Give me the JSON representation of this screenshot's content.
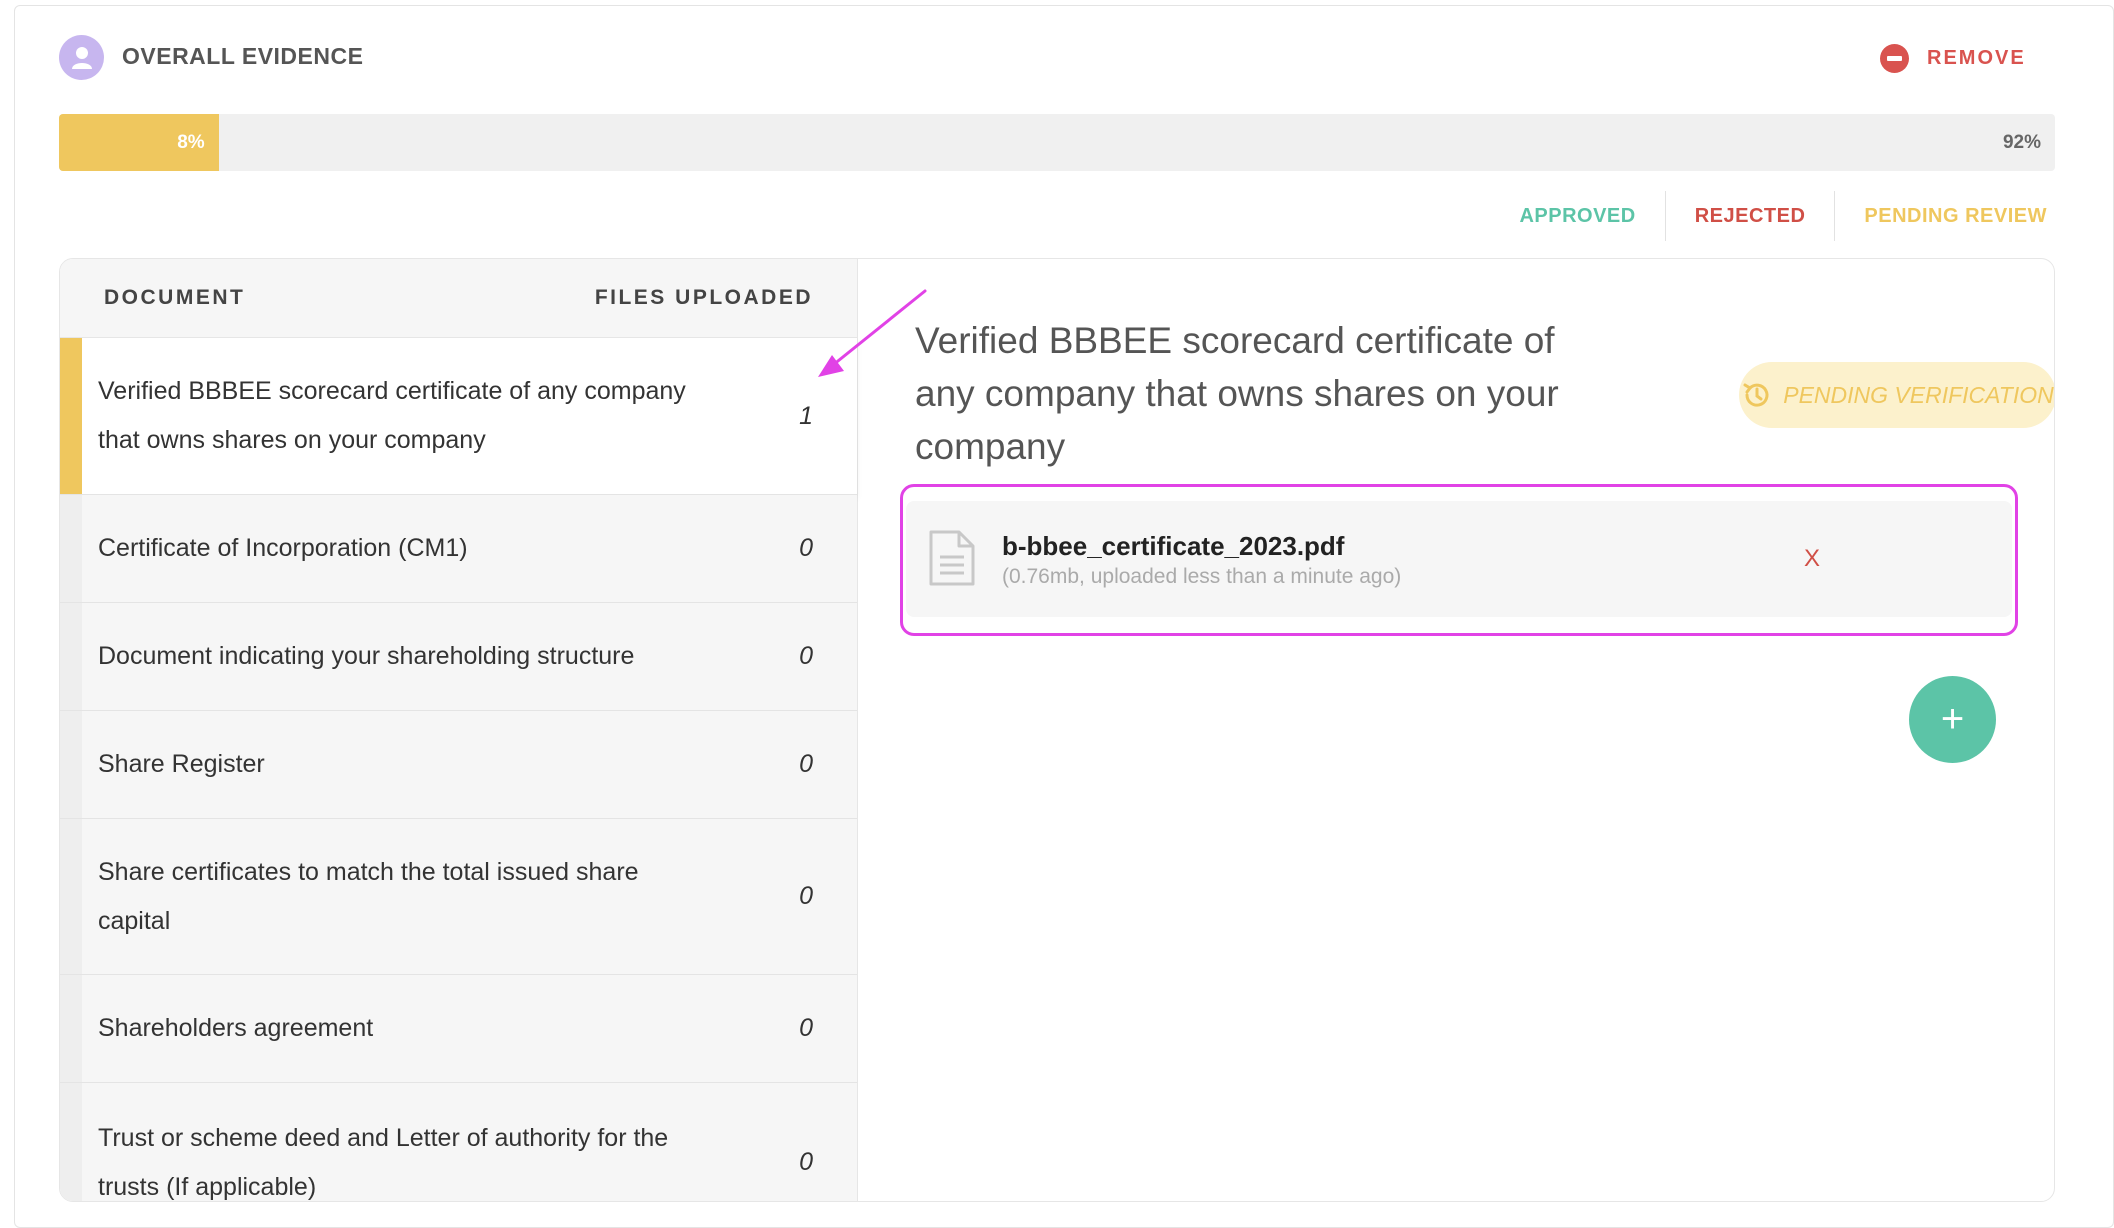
{
  "header": {
    "title": "OVERALL EVIDENCE",
    "remove_label": "REMOVE"
  },
  "progress": {
    "fill_fraction": 0.08,
    "fill_label": "8%",
    "rest_label": "92%"
  },
  "legend": {
    "approved": "APPROVED",
    "rejected": "REJECTED",
    "pending": "PENDING REVIEW"
  },
  "table": {
    "col_document": "DOCUMENT",
    "col_files": "FILES UPLOADED",
    "rows": [
      {
        "name": "Verified BBBEE scorecard certificate of any company that owns shares on your company",
        "count": "1"
      },
      {
        "name": "Certificate of Incorporation (CM1)",
        "count": "0"
      },
      {
        "name": "Document indicating your shareholding structure",
        "count": "0"
      },
      {
        "name": "Share Register",
        "count": "0"
      },
      {
        "name": "Share certificates to match the total issued share capital",
        "count": "0"
      },
      {
        "name": "Shareholders agreement",
        "count": "0"
      },
      {
        "name": "Trust or scheme deed and Letter of authority for the trusts (If applicable)",
        "count": "0"
      }
    ]
  },
  "detail": {
    "title": "Verified BBBEE scorecard certificate of any company that owns shares on your company",
    "status": "PENDING VERIFICATION",
    "file": {
      "name": "b-bbee_certificate_2023.pdf",
      "meta": "(0.76mb, uploaded less than a minute ago)",
      "delete_label": "X"
    },
    "add_label": "+"
  },
  "colors": {
    "accent_yellow": "#efc75e",
    "approved_green": "#5cc4a7",
    "rejected_red": "#d04f46",
    "annotation_magenta": "#e142e6",
    "avatar_purple": "#c7b6ef"
  },
  "icons": [
    "user-icon",
    "remove-circle-icon",
    "history-icon",
    "document-icon",
    "plus-icon"
  ]
}
